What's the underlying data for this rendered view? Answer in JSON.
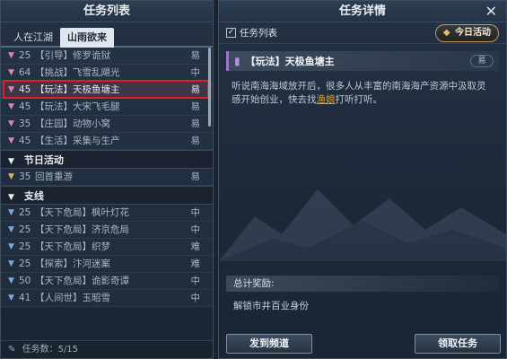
{
  "left": {
    "title": "任务列表",
    "tabs": [
      {
        "label": "人在江湖",
        "active": false
      },
      {
        "label": "山雨欲来",
        "active": true
      }
    ],
    "rows_main": [
      {
        "lvl": "25",
        "name": "【引导】修罗诡狱",
        "diff": "易",
        "icon": "pink"
      },
      {
        "lvl": "64",
        "name": "【挑战】飞雪乱飓光",
        "diff": "中",
        "icon": "pink"
      },
      {
        "lvl": "45",
        "name": "【玩法】天极鱼塘主",
        "diff": "易",
        "icon": "pink",
        "selected": true
      },
      {
        "lvl": "45",
        "name": "【玩法】大宋飞毛腿",
        "diff": "易",
        "icon": "pink"
      },
      {
        "lvl": "35",
        "name": "【庄园】动物小窝",
        "diff": "易",
        "icon": "pink"
      },
      {
        "lvl": "45",
        "name": "【生活】采集与生产",
        "diff": "易",
        "icon": "pink"
      }
    ],
    "section_festival": "节日活动",
    "rows_festival": [
      {
        "lvl": "35",
        "name": "回首重游",
        "diff": "易",
        "icon": "gold"
      }
    ],
    "section_branch": "支线",
    "rows_branch": [
      {
        "lvl": "25",
        "name": "【天下危局】枫叶灯花",
        "diff": "中",
        "icon": "blue"
      },
      {
        "lvl": "25",
        "name": "【天下危局】济京危局",
        "diff": "中",
        "icon": "blue"
      },
      {
        "lvl": "25",
        "name": "【天下危局】织梦",
        "diff": "难",
        "icon": "blue"
      },
      {
        "lvl": "25",
        "name": "【探索】汴河迷案",
        "diff": "难",
        "icon": "blue"
      },
      {
        "lvl": "50",
        "name": "【天下危局】诡影奇谭",
        "diff": "中",
        "icon": "blue"
      },
      {
        "lvl": "41",
        "name": "【人间世】玉昭雪",
        "diff": "中",
        "icon": "blue"
      }
    ],
    "footer": "任务数：5/15"
  },
  "right": {
    "title": "任务详情",
    "close": "✕",
    "checkbox_label": "任务列表",
    "daily_label": "今日活动",
    "task_title": "【玩法】天极鱼塘主",
    "task_diff": "易",
    "desc_before": "听说南海海域放开后，很多人从丰富的南海海产资源中汲取灵感开始创业，快去找",
    "desc_link": "渔娘",
    "desc_after": "打听打听。",
    "reward_header": "总计奖励:",
    "reward_text": "解锁市井百业身份",
    "send_btn": "发到频道",
    "accept_btn": "领取任务"
  }
}
